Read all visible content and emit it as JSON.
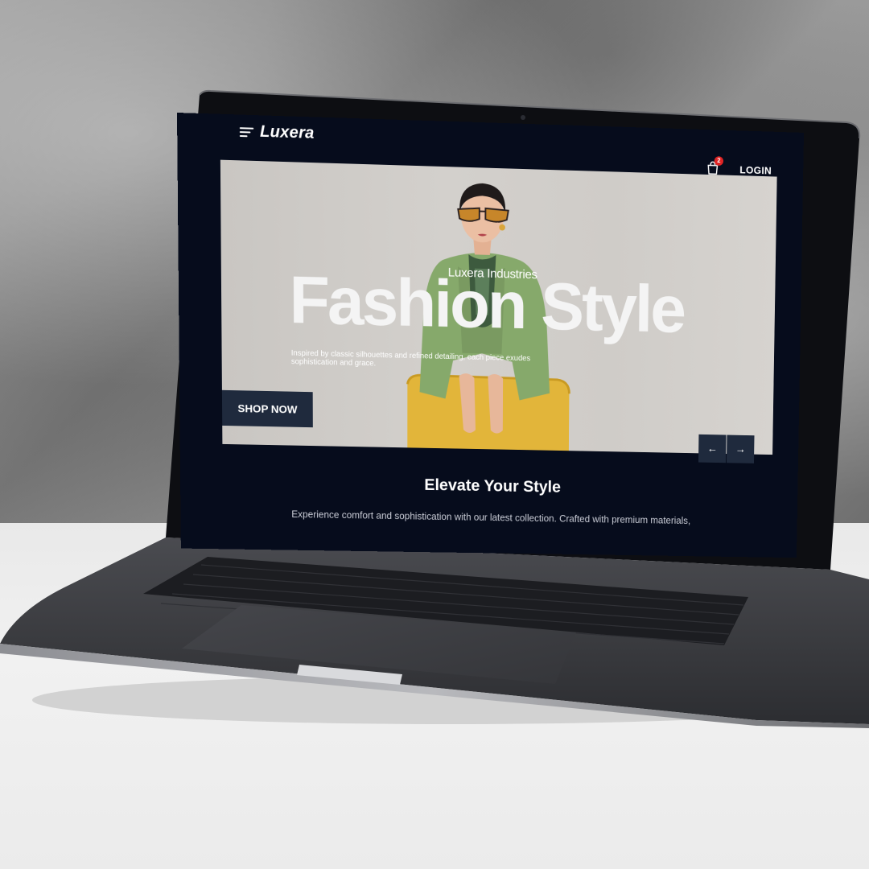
{
  "header": {
    "brand": "Luxera",
    "cart_count": "2",
    "login_label": "LOGIN"
  },
  "hero": {
    "subtitle": "Luxera Industries",
    "title": "Fashion Style",
    "description": "Inspired by classic silhouettes and refined detailing, each piece exudes sophistication and grace.",
    "cta_label": "SHOP NOW",
    "prev_label": "←",
    "next_label": "→"
  },
  "section": {
    "title": "Elevate Your Style",
    "text": "Experience comfort and sophistication with our latest collection. Crafted with premium materials,"
  },
  "colors": {
    "background": "#060c1c",
    "button": "#1f2a3d",
    "badge": "#e02424",
    "text": "#ffffff"
  },
  "icons": {
    "menu": "hamburger-icon",
    "cart": "shopping-bag-icon",
    "prev": "arrow-left-icon",
    "next": "arrow-right-icon"
  }
}
